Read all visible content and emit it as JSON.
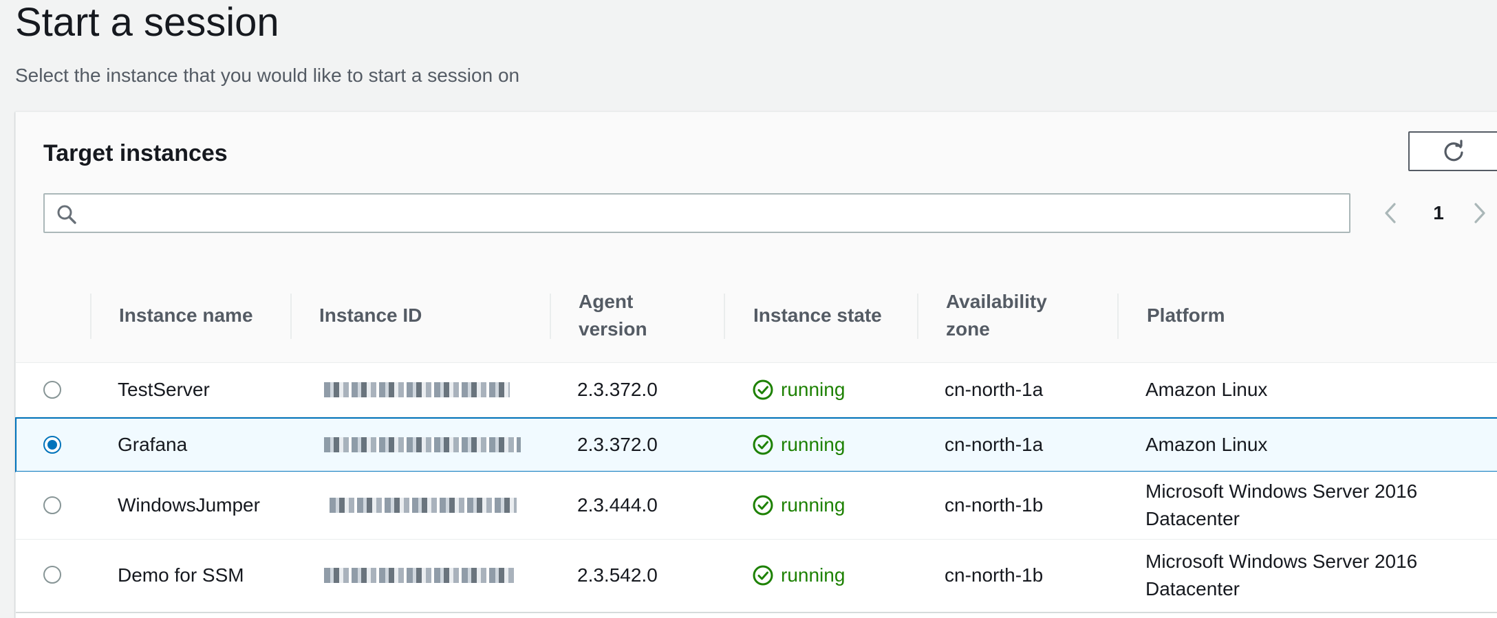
{
  "page": {
    "title": "Start a session",
    "description": "Select the instance that you would like to start a session on"
  },
  "panel": {
    "title": "Target instances",
    "refresh_icon": "refresh-icon",
    "search": {
      "value": "",
      "placeholder": "",
      "icon": "search-icon"
    },
    "pagination": {
      "current_page": "1",
      "prev_icon": "chevron-left-icon",
      "next_icon": "chevron-right-icon"
    }
  },
  "table": {
    "columns": {
      "name": "Instance name",
      "id": "Instance ID",
      "agent": "Agent version",
      "state": "Instance state",
      "zone": "Availability zone",
      "platform": "Platform"
    },
    "rows": [
      {
        "selected": false,
        "name": "TestServer",
        "agent": "2.3.372.0",
        "state": "running",
        "zone": "cn-north-1a",
        "platform": "Amazon Linux"
      },
      {
        "selected": true,
        "name": "Grafana",
        "agent": "2.3.372.0",
        "state": "running",
        "zone": "cn-north-1a",
        "platform": "Amazon Linux"
      },
      {
        "selected": false,
        "name": "WindowsJumper",
        "agent": "2.3.444.0",
        "state": "running",
        "zone": "cn-north-1b",
        "platform": "Microsoft Windows Server 2016 Datacenter"
      },
      {
        "selected": false,
        "name": "Demo for SSM",
        "agent": "2.3.542.0",
        "state": "running",
        "zone": "cn-north-1b",
        "platform": "Microsoft Windows Server 2016 Datacenter"
      }
    ]
  },
  "colors": {
    "accent": "#0073bb",
    "running": "#1d8102",
    "selected_row_bg": "#f1faff"
  }
}
